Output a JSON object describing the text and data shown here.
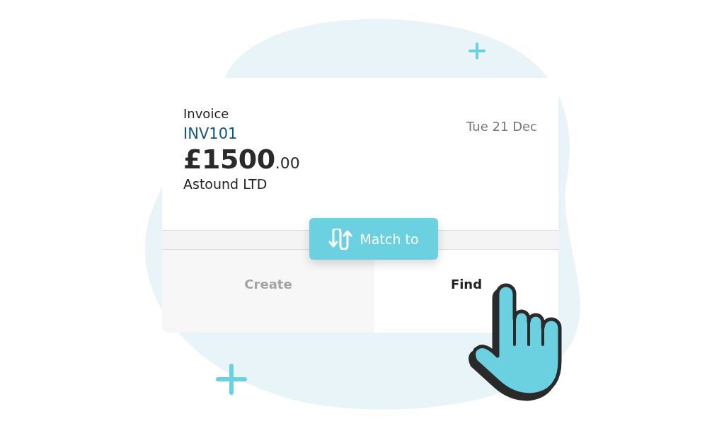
{
  "invoice": {
    "label": "Invoice",
    "number": "INV101",
    "date": "Tue 21 Dec",
    "amount": "£1500",
    "amount_decimals": ".00",
    "customer": "Astound LTD"
  },
  "match_button": {
    "label": "Match to"
  },
  "options": [
    {
      "label": "Create",
      "selected": false
    },
    {
      "label": "Find",
      "selected": true
    }
  ]
}
